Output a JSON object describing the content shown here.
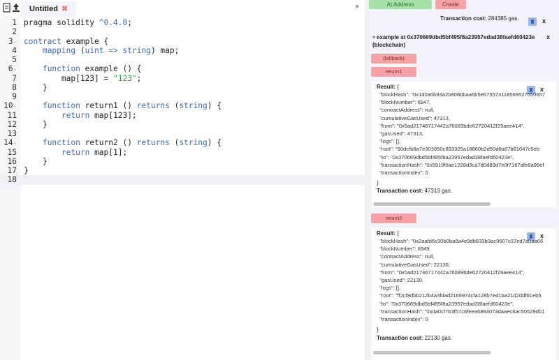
{
  "editor": {
    "tab_title": "Untitled",
    "tab_close": "✖",
    "lines": [
      {
        "num": "1",
        "fold": "",
        "html": "pragma solidity <span class='op'>^0.4.0</span>;"
      },
      {
        "num": "2",
        "fold": "",
        "html": ""
      },
      {
        "num": "3",
        "fold": "▾",
        "html": "<span class='kw'>contract</span> example {"
      },
      {
        "num": "4",
        "fold": "",
        "html": "    <span class='kw'>mapping</span> (<span class='ty'>uint</span> <span class='op'>=&gt;</span> <span class='ty'>string</span>) map;"
      },
      {
        "num": "5",
        "fold": "",
        "html": ""
      },
      {
        "num": "6",
        "fold": "▾",
        "html": "    <span class='kw'>function</span> example () {"
      },
      {
        "num": "7",
        "fold": "",
        "html": "        map[123] = <span class='st'>\"123\"</span>;"
      },
      {
        "num": "8",
        "fold": "",
        "html": "    }"
      },
      {
        "num": "9",
        "fold": "",
        "html": ""
      },
      {
        "num": "10",
        "fold": "▾",
        "html": "    <span class='kw'>function</span> return1 () <span class='kw'>returns</span> (<span class='ty'>string</span>) {"
      },
      {
        "num": "11",
        "fold": "",
        "html": "        <span class='kw'>return</span> map[123];"
      },
      {
        "num": "12",
        "fold": "",
        "html": "    }"
      },
      {
        "num": "13",
        "fold": "",
        "html": ""
      },
      {
        "num": "14",
        "fold": "▾",
        "html": "    <span class='kw'>function</span> return2 () <span class='kw'>returns</span> (<span class='ty'>string</span>) {"
      },
      {
        "num": "15",
        "fold": "",
        "html": "        <span class='kw'>return</span> map[1];"
      },
      {
        "num": "16",
        "fold": "",
        "html": "    }"
      },
      {
        "num": "17",
        "fold": "",
        "html": "}"
      },
      {
        "num": "18",
        "fold": "",
        "html": ""
      }
    ],
    "active_line": 18,
    "collapse_label": "»"
  },
  "panel": {
    "at_address_label": "At Address",
    "create_label": "Create",
    "top_tx_cost_label": "Transaction cost:",
    "top_tx_cost_value": "284385 gas.",
    "close_x": "x",
    "instance_title": "example at 0x370669dbd5bf495f8a23957edad38faefd60423e (blockchain)",
    "fallback_label": "(fallback)",
    "return1_label": "return1",
    "return2_label": "return2",
    "result1": {
      "title": "Result:",
      "open_brace": "{",
      "fields": [
        "\"blockHash\": \"0x1d0a6b93a2b808bbaa6b5e675573118569527650657",
        "\"blockNumber\": 6947,",
        "\"contractAddress\": null,",
        "\"cumulativeGasUsed\": 47313,",
        "\"from\": \"0x5ad21746717442a76089bde62720412f29aee414\",",
        "\"gasUsed\": 47313,",
        "\"logs\": [],",
        "\"root\": \"90dcfb8a7e303950c893325a18860b2d50d8a67b81047c5eb",
        "\"to\": \"0x370669dbd5bf495f8a23957edad38faefd60423e\",",
        "\"transactionHash\": \"0x5919f0ae1228d3ca7d0d89d7e0f7167afe8a99ef",
        "\"transactionIndex\": 0"
      ],
      "close_brace": "}",
      "tx_cost_label": "Transaction cost:",
      "tx_cost_value": "47313 gas."
    },
    "result2": {
      "title": "Result:",
      "open_brace": "{",
      "fields": [
        "\"blockHash\": \"0x2aafd6c30b0ba6a4e9db833b3ac9607c37ed7a0aa66",
        "\"blockNumber\": 6949,",
        "\"contractAddress\": null,",
        "\"cumulativeGasUsed\": 22130,",
        "\"from\": \"0x5ad21746717442a76089bde62720412f29aee414\",",
        "\"gasUsed\": 22130,",
        "\"logs\": [],",
        "\"root\": \"ff2cf8dbb212b4a3fdad2166974cfa128b7ed1ba21d2ddf61eb5",
        "\"to\": \"0x370669dbd5bf495f8a23957edad38faefd60423e\",",
        "\"transactionHash\": \"0xda0cf7b3f57c8feea686407adaaec6ac50529db1",
        "\"transactionIndex\": 0"
      ],
      "close_brace": "}",
      "tx_cost_label": "Transaction cost:",
      "tx_cost_value": "22130 gas."
    }
  }
}
